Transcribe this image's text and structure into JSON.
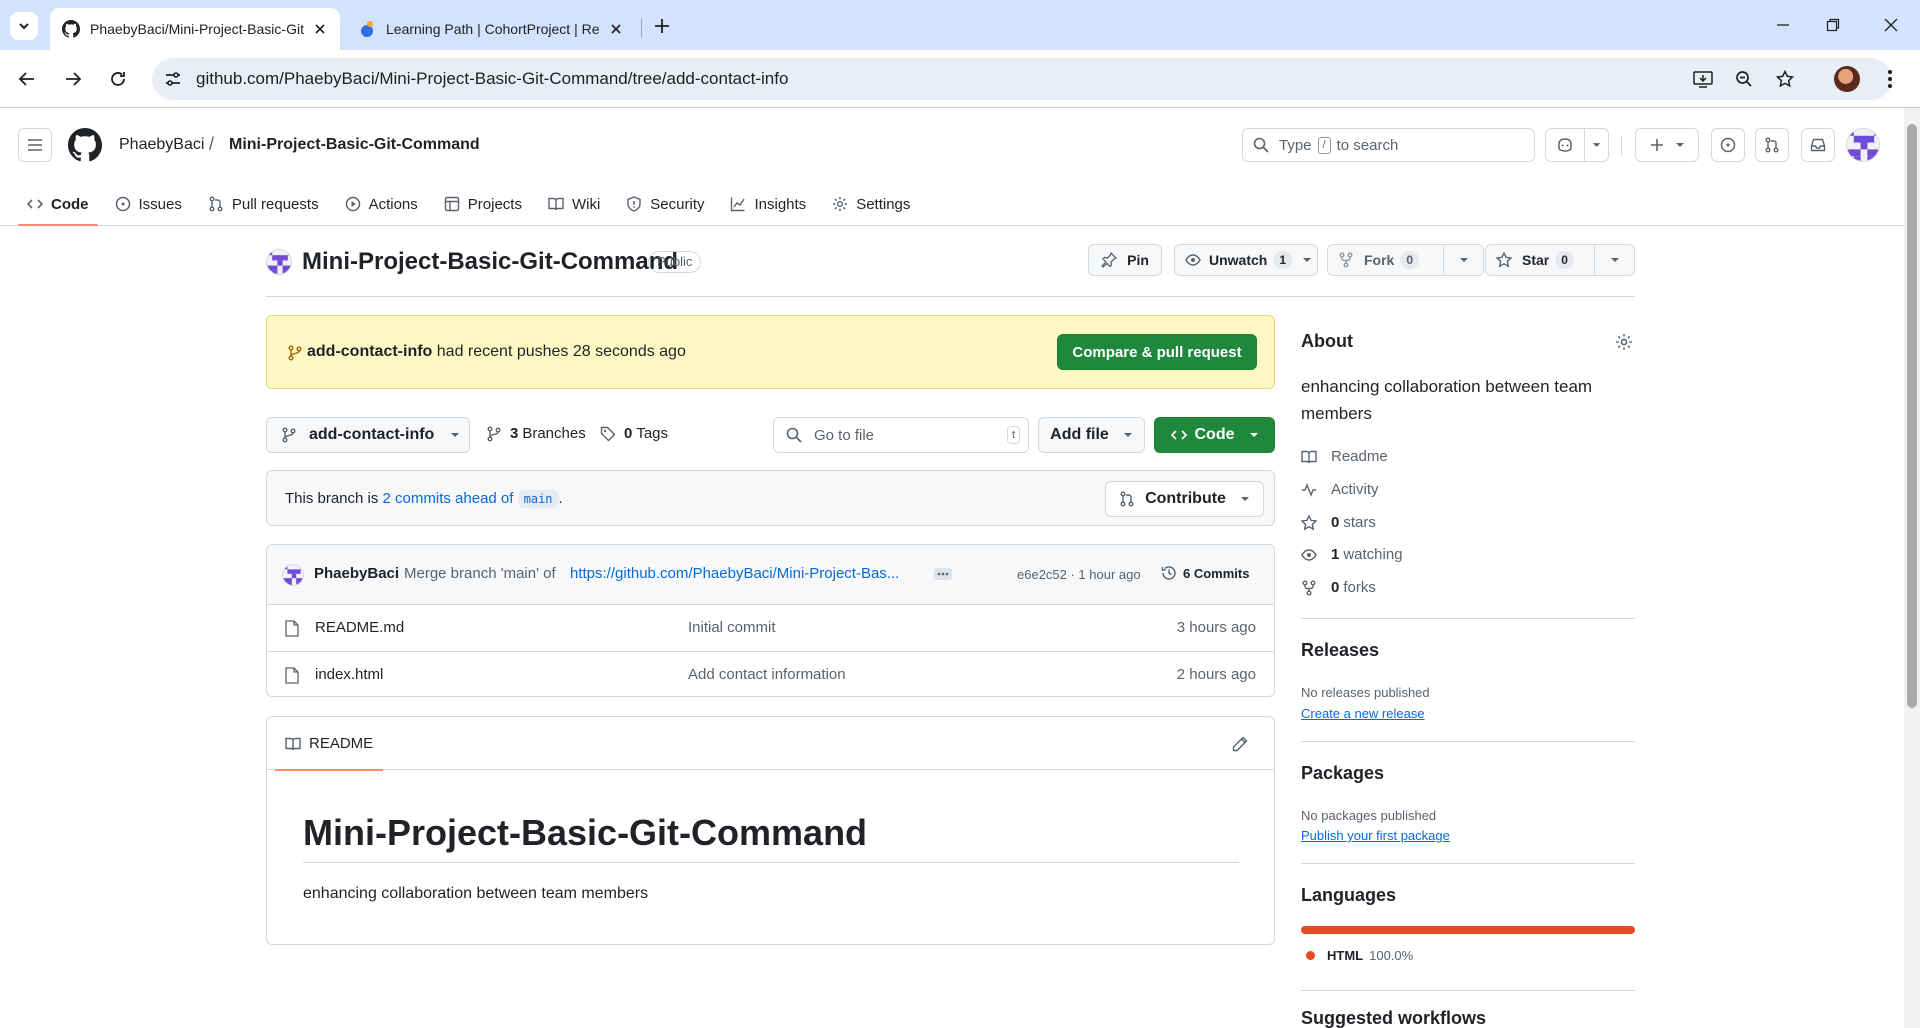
{
  "browser": {
    "tabs": [
      {
        "title": "PhaebyBaci/Mini-Project-Basic-Git-Command"
      },
      {
        "title": "Learning Path | CohortProject | Revou"
      }
    ],
    "url": "github.com/PhaebyBaci/Mini-Project-Basic-Git-Command/tree/add-contact-info"
  },
  "header": {
    "owner": "PhaebyBaci",
    "separator": "/",
    "repo": "Mini-Project-Basic-Git-Command",
    "search_prefix": "Type",
    "search_key": "/",
    "search_suffix": "to search"
  },
  "repo_nav": [
    {
      "label": "Code",
      "icon": "code-icon"
    },
    {
      "label": "Issues",
      "icon": "issue-icon"
    },
    {
      "label": "Pull requests",
      "icon": "pull-request-icon"
    },
    {
      "label": "Actions",
      "icon": "play-icon"
    },
    {
      "label": "Projects",
      "icon": "table-icon"
    },
    {
      "label": "Wiki",
      "icon": "book-icon"
    },
    {
      "label": "Security",
      "icon": "shield-icon"
    },
    {
      "label": "Insights",
      "icon": "graph-icon"
    },
    {
      "label": "Settings",
      "icon": "gear-icon"
    }
  ],
  "repo_head": {
    "title": "Mini-Project-Basic-Git-Command",
    "visibility": "Public",
    "pin": "Pin",
    "unwatch": "Unwatch",
    "watch_count": "1",
    "fork": "Fork",
    "fork_count": "0",
    "star": "Star",
    "star_count": "0"
  },
  "flash": {
    "branch": "add-contact-info",
    "text": "had recent pushes 28 seconds ago",
    "button": "Compare & pull request"
  },
  "bar": {
    "branch": "add-contact-info",
    "branches_count": "3",
    "branches_label": "Branches",
    "tags_count": "0",
    "tags_label": "Tags",
    "goto_placeholder": "Go to file",
    "goto_key": "t",
    "add_file": "Add file",
    "code": "Code"
  },
  "ahead": {
    "prefix": "This branch is",
    "link": "2 commits ahead of",
    "base": "main",
    "suffix": ".",
    "contribute": "Contribute"
  },
  "commit": {
    "author": "PhaebyBaci",
    "message": "Merge branch 'main' of",
    "link": "https://github.com/PhaebyBaci/Mini-Project-Bas...",
    "sha_time": "e6e2c52 · 1 hour ago",
    "commits": "6 Commits"
  },
  "files": [
    {
      "name": "README.md",
      "message": "Initial commit",
      "time": "3 hours ago"
    },
    {
      "name": "index.html",
      "message": "Add contact information",
      "time": "2 hours ago"
    }
  ],
  "readme": {
    "tab": "README",
    "h1": "Mini-Project-Basic-Git-Command",
    "p": "enhancing collaboration between team members"
  },
  "about": {
    "heading": "About",
    "description": "enhancing collaboration between team members",
    "readme": "Readme",
    "activity": "Activity",
    "stars_count": "0",
    "stars_label": "stars",
    "watching_count": "1",
    "watching_label": "watching",
    "forks_count": "0",
    "forks_label": "forks"
  },
  "releases": {
    "heading": "Releases",
    "none": "No releases published",
    "link": "Create a new release"
  },
  "packages": {
    "heading": "Packages",
    "none": "No packages published",
    "link": "Publish your first package"
  },
  "languages": {
    "heading": "Languages",
    "items": [
      {
        "name": "HTML",
        "percent": "100.0%",
        "share": 100,
        "color": "#e34c26"
      }
    ]
  },
  "suggested": {
    "heading": "Suggested workflows"
  },
  "colors": {
    "accent": "#fd8c73",
    "primary_green": "#1f883d",
    "link_blue": "#0969da",
    "flash_bg": "#fff8c5"
  }
}
